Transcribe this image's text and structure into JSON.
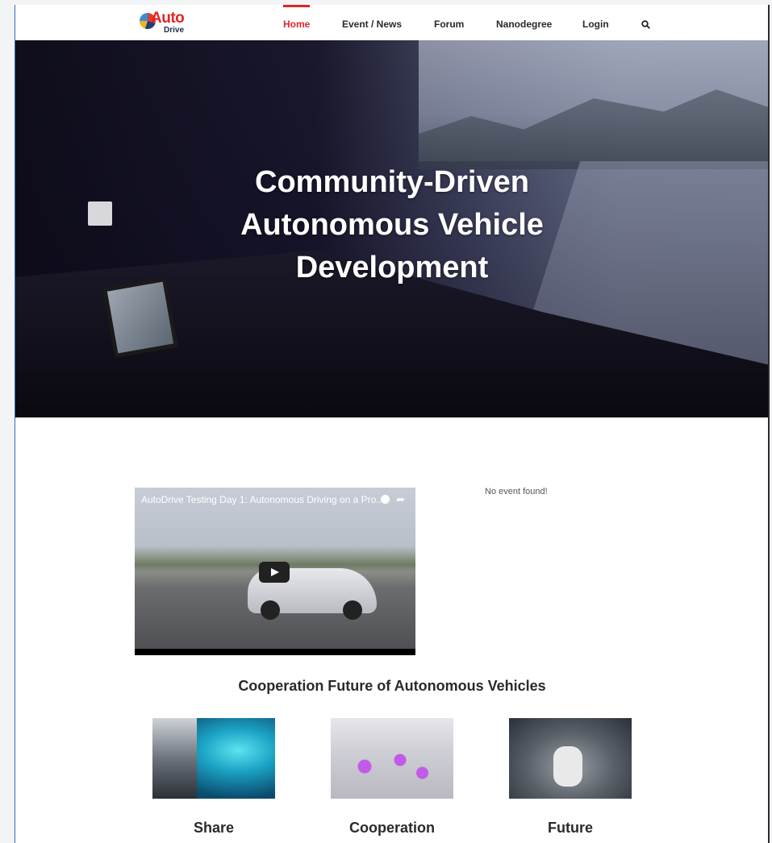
{
  "logo": {
    "line1": "Auto",
    "line2": "Drive"
  },
  "nav": {
    "items": [
      {
        "label": "Home",
        "active": true
      },
      {
        "label": "Event / News",
        "active": false
      },
      {
        "label": "Forum",
        "active": false
      },
      {
        "label": "Nanodegree",
        "active": false
      },
      {
        "label": "Login",
        "active": false
      }
    ],
    "search_icon": "search-icon"
  },
  "hero": {
    "title_line1": "Community-Driven",
    "title_line2": "Autonomous Vehicle",
    "title_line3": "Development"
  },
  "video": {
    "title": "AutoDrive Testing Day 1: Autonomous Driving on a Pro..."
  },
  "events": {
    "empty_text": "No event found!"
  },
  "cooperation": {
    "title": "Cooperation Future of Autonomous Vehicles",
    "cards": [
      {
        "label": "Share"
      },
      {
        "label": "Cooperation"
      },
      {
        "label": "Future"
      }
    ]
  },
  "colors": {
    "accent": "#e02424",
    "text": "#2a2a2a"
  }
}
